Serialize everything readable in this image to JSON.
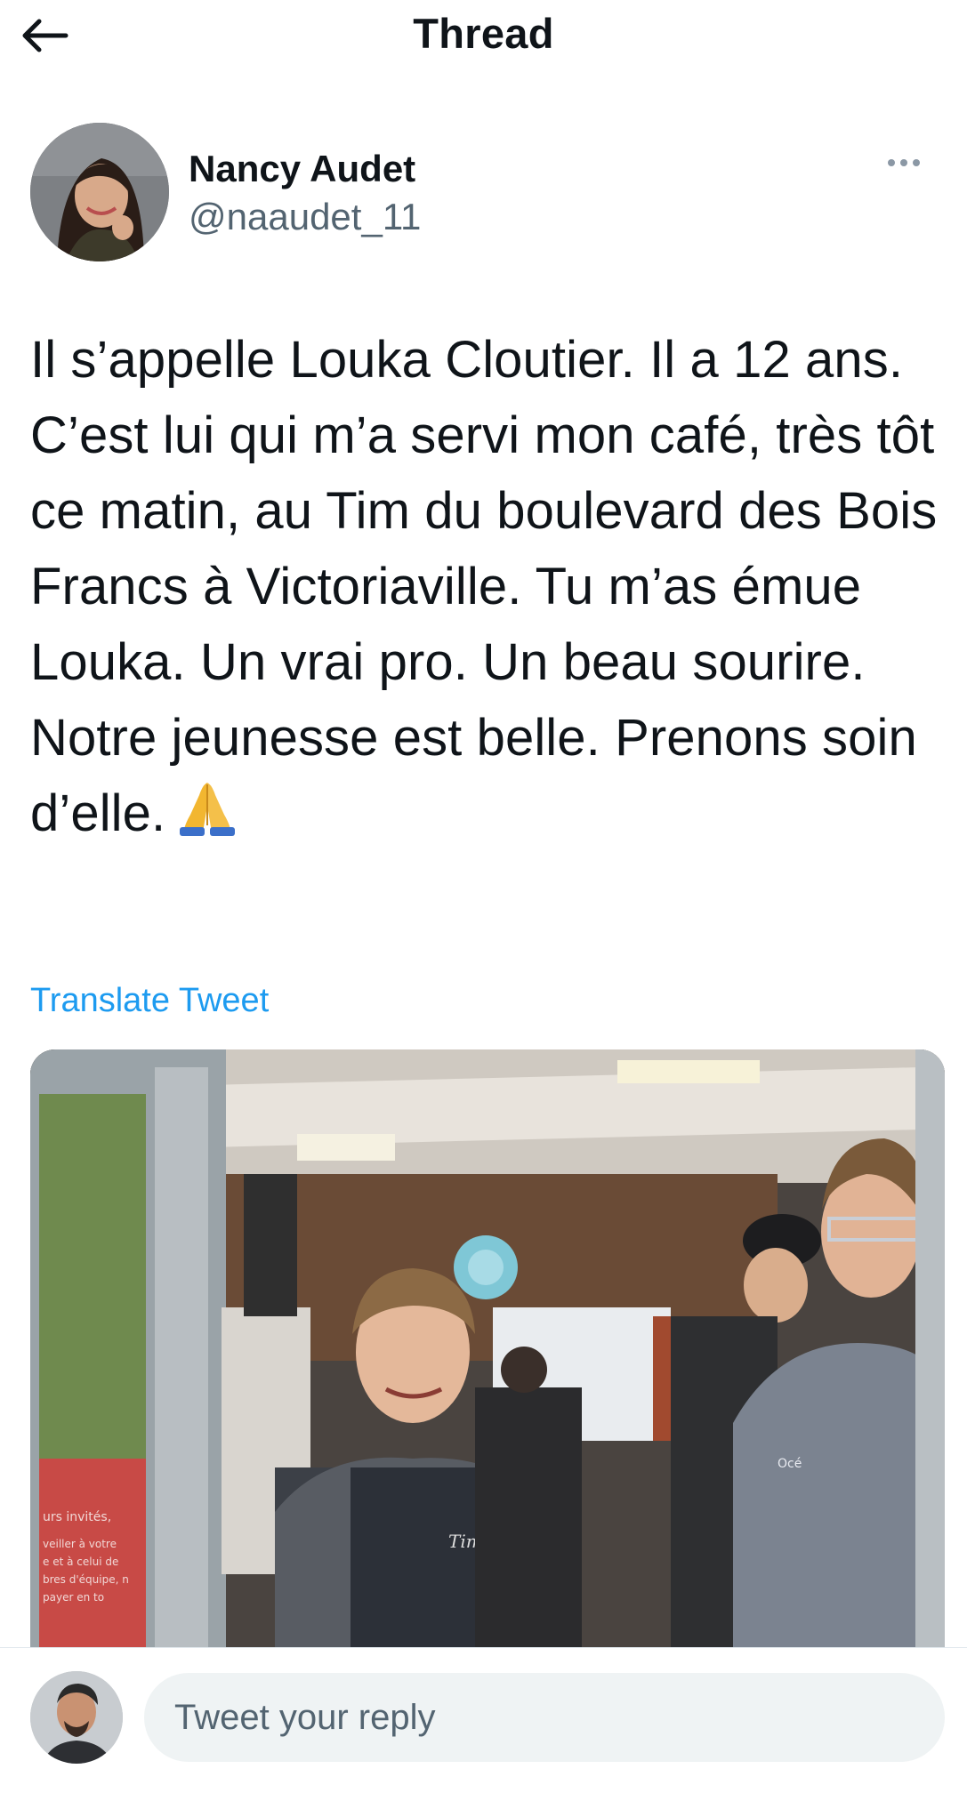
{
  "header": {
    "title": "Thread",
    "back_icon": "arrow-left-icon"
  },
  "tweet": {
    "author_name": "Nancy Audet",
    "author_handle": "@naaudet_11",
    "more_icon": "more-horizontal-icon",
    "text": "Il s’appelle Louka Cloutier. Il a 12 ans. C’est lui qui m’a servi mon café, très tôt ce matin, au Tim du boulevard des Bois Francs à Victoriaville. Tu m’as émue Louka. Un vrai pro. Un beau sourire. Notre jeunesse est belle. Prenons soin d’elle.",
    "emoji_icon": "folded-hands-icon",
    "translate_label": "Translate Tweet",
    "photo": {
      "sign_text": "urs invités, veiller à votre e et à celui de bres d'équipe, nous payer en tou votre carte de crédit débit sur le lecteur. Ve noter que l'argent com est tout de même acc Merci.",
      "cup_logo": "Tim Hortons",
      "sweater_logo": "Océ"
    }
  },
  "reply": {
    "placeholder": "Tweet your reply"
  },
  "colors": {
    "accent": "#1d9bf0",
    "text_primary": "#0f1419",
    "text_secondary": "#536471",
    "input_bg": "#eff3f4"
  }
}
